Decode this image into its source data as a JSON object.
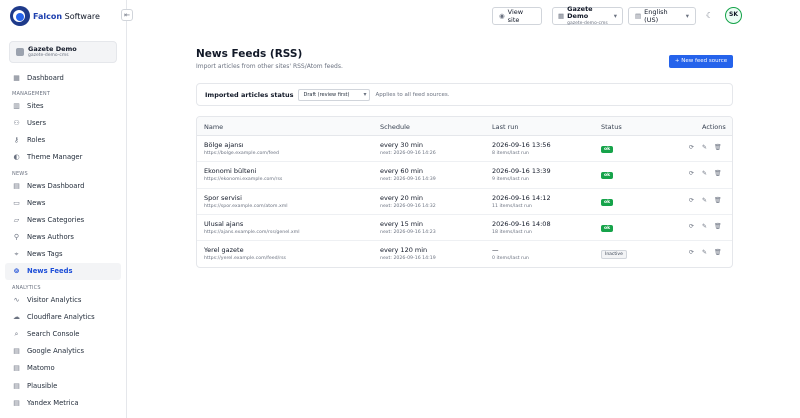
{
  "brand": {
    "name": "Falcon",
    "suffix": " Software"
  },
  "sidebar": {
    "tenant": {
      "title": "Gazete Demo",
      "subtitle": "gazete-demo-cms"
    },
    "items": [
      {
        "type": "item",
        "label": "Dashboard",
        "icon": "grid-icon"
      },
      {
        "type": "section",
        "label": "MANAGEMENT"
      },
      {
        "type": "item",
        "label": "Sites",
        "icon": "building-icon"
      },
      {
        "type": "item",
        "label": "Users",
        "icon": "users-icon"
      },
      {
        "type": "item",
        "label": "Roles",
        "icon": "key-icon"
      },
      {
        "type": "item",
        "label": "Theme Manager",
        "icon": "palette-icon"
      },
      {
        "type": "section",
        "label": "NEWS"
      },
      {
        "type": "item",
        "label": "News Dashboard",
        "icon": "chart-icon"
      },
      {
        "type": "item",
        "label": "News",
        "icon": "document-icon"
      },
      {
        "type": "item",
        "label": "News Categories",
        "icon": "folder-icon"
      },
      {
        "type": "item",
        "label": "News Authors",
        "icon": "user-icon"
      },
      {
        "type": "item",
        "label": "News Tags",
        "icon": "tag-icon"
      },
      {
        "type": "item",
        "label": "News Feeds",
        "icon": "rss-icon",
        "active": true
      },
      {
        "type": "section",
        "label": "ANALYTICS"
      },
      {
        "type": "item",
        "label": "Visitor Analytics",
        "icon": "activity-icon"
      },
      {
        "type": "item",
        "label": "Cloudflare Analytics",
        "icon": "cloud-icon"
      },
      {
        "type": "item",
        "label": "Search Console",
        "icon": "search-icon"
      },
      {
        "type": "item",
        "label": "Google Analytics",
        "icon": "chart-icon"
      },
      {
        "type": "item",
        "label": "Matomo",
        "icon": "chart-icon"
      },
      {
        "type": "item",
        "label": "Plausible",
        "icon": "chart-icon"
      },
      {
        "type": "item",
        "label": "Yandex Metrica",
        "icon": "chart-icon"
      }
    ]
  },
  "topbar": {
    "view_site": "View site",
    "tenant_title": "Gazete Demo",
    "tenant_subtitle": "gazete-demo-cms",
    "language": "English (US)",
    "avatar_initials": "SK"
  },
  "page": {
    "title": "News Feeds (RSS)",
    "subtitle": "Import articles from other sites' RSS/Atom feeds.",
    "add_button": "+ New feed source",
    "status_label": "Imported articles status",
    "status_value": "Draft (review first)",
    "status_hint": "Applies to all feed sources."
  },
  "table": {
    "headers": {
      "name": "Name",
      "schedule": "Schedule",
      "last_run": "Last run",
      "status": "Status",
      "actions": "Actions"
    },
    "rows": [
      {
        "name": "Bölge ajansı",
        "url": "https://bolge.example.com/feed",
        "schedule": "every 30 min",
        "next": "next: 2026-09-16 14:26",
        "last_run": "2026-09-16 13:56",
        "last_detail": "8 items/last run",
        "status": "ok"
      },
      {
        "name": "Ekonomi bülteni",
        "url": "https://ekonomi.example.com/rss",
        "schedule": "every 60 min",
        "next": "next: 2026-09-16 14:39",
        "last_run": "2026-09-16 13:39",
        "last_detail": "9 items/last run",
        "status": "ok"
      },
      {
        "name": "Spor servisi",
        "url": "https://spor.example.com/atom.xml",
        "schedule": "every 20 min",
        "next": "next: 2026-09-16 14:32",
        "last_run": "2026-09-16 14:12",
        "last_detail": "11 items/last run",
        "status": "ok"
      },
      {
        "name": "Ulusal ajans",
        "url": "https://ajans.example.com/rss/genel.xml",
        "schedule": "every 15 min",
        "next": "next: 2026-09-16 14:23",
        "last_run": "2026-09-16 14:08",
        "last_detail": "18 items/last run",
        "status": "ok"
      },
      {
        "name": "Yerel gazete",
        "url": "https://yerel.example.com/feed/rss",
        "schedule": "every 120 min",
        "next": "next: 2026-09-16 14:19",
        "last_run": "—",
        "last_detail": "0 items/last run",
        "status": "Inactive"
      }
    ]
  }
}
